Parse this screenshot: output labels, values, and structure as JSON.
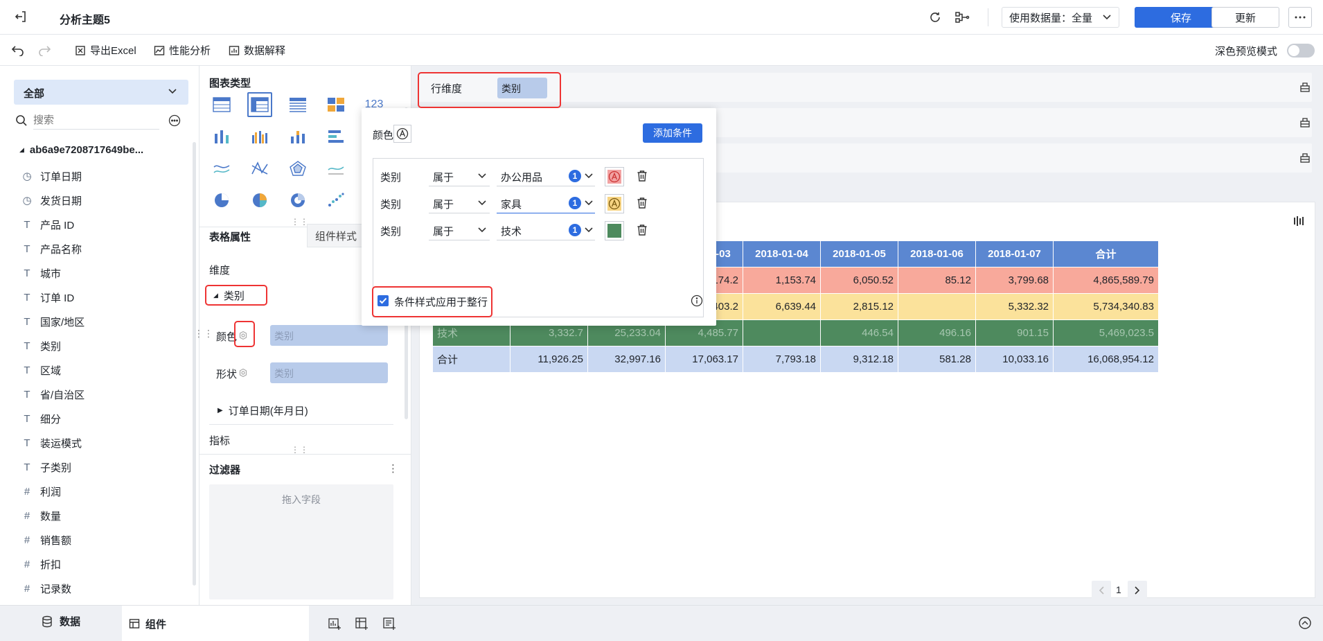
{
  "header": {
    "title": "分析主题5",
    "data_usage": "使用数据量：全量",
    "save_label": "保存",
    "update_label": "更新"
  },
  "toolbar": {
    "export_excel": "导出Excel",
    "performance": "性能分析",
    "data_explain": "数据解释",
    "dark_preview": "深色预览模式"
  },
  "fields": {
    "scope": "全部",
    "search_placeholder": "搜索",
    "dataset": "ab6a9e7208717649be...",
    "items": [
      {
        "type": "date",
        "label": "订单日期"
      },
      {
        "type": "date",
        "label": "发货日期"
      },
      {
        "type": "text",
        "label": "产品 ID"
      },
      {
        "type": "text",
        "label": "产品名称"
      },
      {
        "type": "text",
        "label": "城市"
      },
      {
        "type": "text",
        "label": "订单 ID"
      },
      {
        "type": "text",
        "label": "国家/地区"
      },
      {
        "type": "text",
        "label": "类别"
      },
      {
        "type": "text",
        "label": "区域"
      },
      {
        "type": "text",
        "label": "省/自治区"
      },
      {
        "type": "text",
        "label": "细分"
      },
      {
        "type": "text",
        "label": "装运模式"
      },
      {
        "type": "text",
        "label": "子类别"
      },
      {
        "type": "number",
        "label": "利润"
      },
      {
        "type": "number",
        "label": "数量"
      },
      {
        "type": "number",
        "label": "销售额"
      },
      {
        "type": "number",
        "label": "折扣"
      },
      {
        "type": "number",
        "label": "记录数"
      }
    ]
  },
  "attr": {
    "chart_type_title": "图表类型",
    "number_type": "123",
    "tab_table": "表格属性",
    "tab_component": "组件样式",
    "dimension_label": "维度",
    "dimension_field": "类别",
    "color_label": "颜色",
    "color_field": "类别",
    "shape_label": "形状",
    "shape_field": "类别",
    "date_field": "订单日期(年月日)",
    "measure_label": "指标",
    "filter_label": "过滤器",
    "drop_hint": "拖入字段"
  },
  "canvas": {
    "row_dim_label": "行维度",
    "row_dim_field": "类别",
    "page": "1"
  },
  "table": {
    "headers": [
      "2018-01-03",
      "2018-01-04",
      "2018-01-05",
      "2018-01-06",
      "2018-01-07",
      "合计"
    ],
    "rows": [
      {
        "label": "",
        "cells": [
          "",
          "",
          "12,174.2",
          "1,153.74",
          "6,050.52",
          "85.12",
          "3,799.68",
          "4,865,589.79"
        ]
      },
      {
        "label": "",
        "cells": [
          "",
          "",
          "403.2",
          "6,639.44",
          "2,815.12",
          "",
          "5,332.32",
          "5,734,340.83"
        ]
      },
      {
        "label": "技术",
        "cells": [
          "3,332.7",
          "25,233.04",
          "4,485.77",
          "",
          "446.54",
          "496.16",
          "901.15",
          "5,469,023.5"
        ]
      },
      {
        "label": "合计",
        "cells": [
          "11,926.25",
          "32,997.16",
          "17,063.17",
          "7,793.18",
          "9,312.18",
          "581.28",
          "10,033.16",
          "16,068,954.12"
        ]
      }
    ]
  },
  "popup": {
    "color_label": "颜色",
    "add_condition": "添加条件",
    "conditions": [
      {
        "field": "类别",
        "op": "属于",
        "value": "办公用品",
        "count": "1",
        "swatch": "#f2a3a3"
      },
      {
        "field": "类别",
        "op": "属于",
        "value": "家具",
        "count": "1",
        "swatch": "#f7d483"
      },
      {
        "field": "类别",
        "op": "属于",
        "value": "技术",
        "count": "1",
        "swatch": "#4d8a5d"
      }
    ],
    "apply_row": "条件样式应用于整行"
  },
  "bottom": {
    "data_tab": "数据",
    "component_tab": "组件"
  },
  "colors": {
    "accent": "#2d6ce0",
    "row_office": "#f8a99b",
    "row_furniture": "#fbe29b",
    "row_tech": "#4e8a5e",
    "row_total": "#c9d8f2",
    "header": "#5b87d1"
  }
}
